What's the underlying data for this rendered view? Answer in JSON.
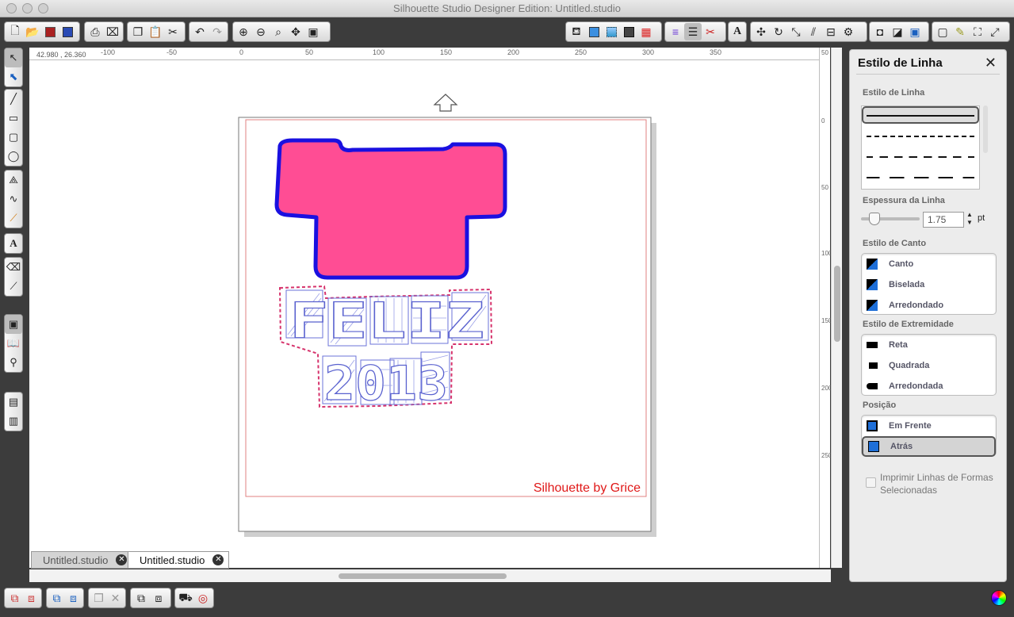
{
  "window": {
    "title": "Silhouette Studio Designer Edition: Untitled.studio"
  },
  "ruler": {
    "coords": "42.980 , 26.360",
    "h_ticks": [
      "-100",
      "-50",
      "0",
      "50",
      "100",
      "150",
      "200",
      "250",
      "300",
      "350"
    ],
    "v_ticks": [
      "50",
      "0",
      "50",
      "100",
      "150",
      "200",
      "250"
    ]
  },
  "tabs": [
    {
      "label": "Untitled.studio",
      "active": false
    },
    {
      "label": "Untitled.studio",
      "active": true
    }
  ],
  "canvas": {
    "watermark": "Silhouette by Grice",
    "text_row1": "FELIZ",
    "text_row2": "2013",
    "fill_color": "#ff4d94",
    "stroke_color": "#1a10e0",
    "cut_line_color": "#d6336c"
  },
  "panel": {
    "title": "Estilo de Linha",
    "line_style_label": "Estilo de Linha",
    "thickness_label": "Espessura da Linha",
    "thickness_value": "1.75",
    "thickness_unit": "pt",
    "corner_label": "Estilo de Canto",
    "corner_options": [
      "Canto",
      "Biselada",
      "Arredondado"
    ],
    "cap_label": "Estilo de Extremidade",
    "cap_options": [
      "Reta",
      "Quadrada",
      "Arredondada"
    ],
    "position_label": "Posição",
    "position_options": [
      "Em Frente",
      "Atrás"
    ],
    "position_selected": "Atrás",
    "print_lines_label": "Imprimir Linhas de Formas Selecionadas"
  },
  "icons": [
    "new-doc-icon",
    "open-icon",
    "save-icon",
    "print-icon",
    "undo-icon",
    "redo-icon",
    "zoom-in-icon",
    "zoom-out-icon",
    "pan-icon",
    "select-icon",
    "line-tool-icon",
    "rectangle-tool-icon",
    "ellipse-tool-icon",
    "text-tool-icon",
    "eraser-tool-icon",
    "knife-tool-icon",
    "close-icon",
    "color-wheel-icon"
  ]
}
